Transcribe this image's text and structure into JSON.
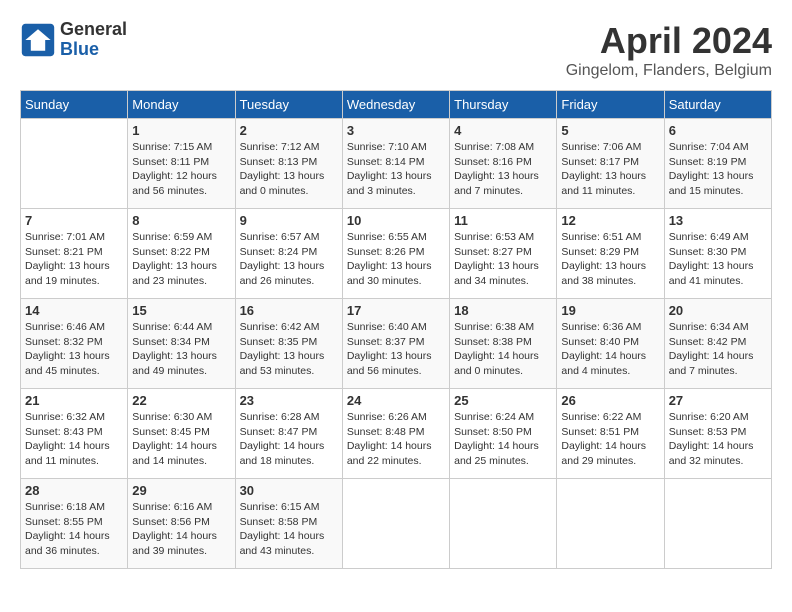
{
  "header": {
    "logo_general": "General",
    "logo_blue": "Blue",
    "month": "April 2024",
    "location": "Gingelom, Flanders, Belgium"
  },
  "weekdays": [
    "Sunday",
    "Monday",
    "Tuesday",
    "Wednesday",
    "Thursday",
    "Friday",
    "Saturday"
  ],
  "days": [
    {
      "num": "",
      "info": ""
    },
    {
      "num": "1",
      "info": "Sunrise: 7:15 AM\nSunset: 8:11 PM\nDaylight: 12 hours\nand 56 minutes."
    },
    {
      "num": "2",
      "info": "Sunrise: 7:12 AM\nSunset: 8:13 PM\nDaylight: 13 hours\nand 0 minutes."
    },
    {
      "num": "3",
      "info": "Sunrise: 7:10 AM\nSunset: 8:14 PM\nDaylight: 13 hours\nand 3 minutes."
    },
    {
      "num": "4",
      "info": "Sunrise: 7:08 AM\nSunset: 8:16 PM\nDaylight: 13 hours\nand 7 minutes."
    },
    {
      "num": "5",
      "info": "Sunrise: 7:06 AM\nSunset: 8:17 PM\nDaylight: 13 hours\nand 11 minutes."
    },
    {
      "num": "6",
      "info": "Sunrise: 7:04 AM\nSunset: 8:19 PM\nDaylight: 13 hours\nand 15 minutes."
    },
    {
      "num": "7",
      "info": "Sunrise: 7:01 AM\nSunset: 8:21 PM\nDaylight: 13 hours\nand 19 minutes."
    },
    {
      "num": "8",
      "info": "Sunrise: 6:59 AM\nSunset: 8:22 PM\nDaylight: 13 hours\nand 23 minutes."
    },
    {
      "num": "9",
      "info": "Sunrise: 6:57 AM\nSunset: 8:24 PM\nDaylight: 13 hours\nand 26 minutes."
    },
    {
      "num": "10",
      "info": "Sunrise: 6:55 AM\nSunset: 8:26 PM\nDaylight: 13 hours\nand 30 minutes."
    },
    {
      "num": "11",
      "info": "Sunrise: 6:53 AM\nSunset: 8:27 PM\nDaylight: 13 hours\nand 34 minutes."
    },
    {
      "num": "12",
      "info": "Sunrise: 6:51 AM\nSunset: 8:29 PM\nDaylight: 13 hours\nand 38 minutes."
    },
    {
      "num": "13",
      "info": "Sunrise: 6:49 AM\nSunset: 8:30 PM\nDaylight: 13 hours\nand 41 minutes."
    },
    {
      "num": "14",
      "info": "Sunrise: 6:46 AM\nSunset: 8:32 PM\nDaylight: 13 hours\nand 45 minutes."
    },
    {
      "num": "15",
      "info": "Sunrise: 6:44 AM\nSunset: 8:34 PM\nDaylight: 13 hours\nand 49 minutes."
    },
    {
      "num": "16",
      "info": "Sunrise: 6:42 AM\nSunset: 8:35 PM\nDaylight: 13 hours\nand 53 minutes."
    },
    {
      "num": "17",
      "info": "Sunrise: 6:40 AM\nSunset: 8:37 PM\nDaylight: 13 hours\nand 56 minutes."
    },
    {
      "num": "18",
      "info": "Sunrise: 6:38 AM\nSunset: 8:38 PM\nDaylight: 14 hours\nand 0 minutes."
    },
    {
      "num": "19",
      "info": "Sunrise: 6:36 AM\nSunset: 8:40 PM\nDaylight: 14 hours\nand 4 minutes."
    },
    {
      "num": "20",
      "info": "Sunrise: 6:34 AM\nSunset: 8:42 PM\nDaylight: 14 hours\nand 7 minutes."
    },
    {
      "num": "21",
      "info": "Sunrise: 6:32 AM\nSunset: 8:43 PM\nDaylight: 14 hours\nand 11 minutes."
    },
    {
      "num": "22",
      "info": "Sunrise: 6:30 AM\nSunset: 8:45 PM\nDaylight: 14 hours\nand 14 minutes."
    },
    {
      "num": "23",
      "info": "Sunrise: 6:28 AM\nSunset: 8:47 PM\nDaylight: 14 hours\nand 18 minutes."
    },
    {
      "num": "24",
      "info": "Sunrise: 6:26 AM\nSunset: 8:48 PM\nDaylight: 14 hours\nand 22 minutes."
    },
    {
      "num": "25",
      "info": "Sunrise: 6:24 AM\nSunset: 8:50 PM\nDaylight: 14 hours\nand 25 minutes."
    },
    {
      "num": "26",
      "info": "Sunrise: 6:22 AM\nSunset: 8:51 PM\nDaylight: 14 hours\nand 29 minutes."
    },
    {
      "num": "27",
      "info": "Sunrise: 6:20 AM\nSunset: 8:53 PM\nDaylight: 14 hours\nand 32 minutes."
    },
    {
      "num": "28",
      "info": "Sunrise: 6:18 AM\nSunset: 8:55 PM\nDaylight: 14 hours\nand 36 minutes."
    },
    {
      "num": "29",
      "info": "Sunrise: 6:16 AM\nSunset: 8:56 PM\nDaylight: 14 hours\nand 39 minutes."
    },
    {
      "num": "30",
      "info": "Sunrise: 6:15 AM\nSunset: 8:58 PM\nDaylight: 14 hours\nand 43 minutes."
    },
    {
      "num": "",
      "info": ""
    },
    {
      "num": "",
      "info": ""
    },
    {
      "num": "",
      "info": ""
    },
    {
      "num": "",
      "info": ""
    }
  ]
}
